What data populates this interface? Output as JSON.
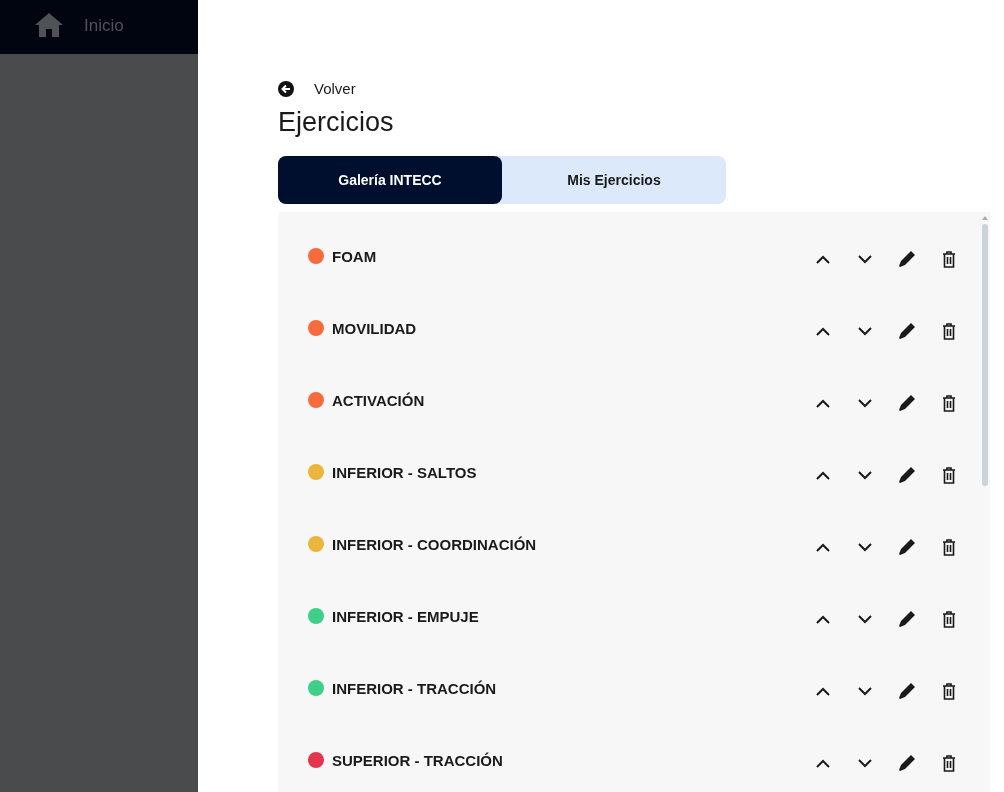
{
  "sidebar": {
    "home": {
      "label": "Inicio"
    }
  },
  "back": {
    "label": "Volver"
  },
  "title": "Ejercicios",
  "tabs": [
    {
      "label": "Galería INTECC",
      "selected": true
    },
    {
      "label": "Mis Ejercicios",
      "selected": false
    }
  ],
  "categories": [
    {
      "name": "FOAM",
      "color": "#f76b3e"
    },
    {
      "name": "MOVILIDAD",
      "color": "#f76b3e"
    },
    {
      "name": "ACTIVACIÓN",
      "color": "#f76b3e"
    },
    {
      "name": "INFERIOR - SALTOS",
      "color": "#eab63c"
    },
    {
      "name": "INFERIOR - COORDINACIÓN",
      "color": "#eab63c"
    },
    {
      "name": "INFERIOR - EMPUJE",
      "color": "#3fcf88"
    },
    {
      "name": "INFERIOR - TRACCIÓN",
      "color": "#3fcf88"
    },
    {
      "name": "SUPERIOR - TRACCIÓN",
      "color": "#e2364f"
    }
  ]
}
